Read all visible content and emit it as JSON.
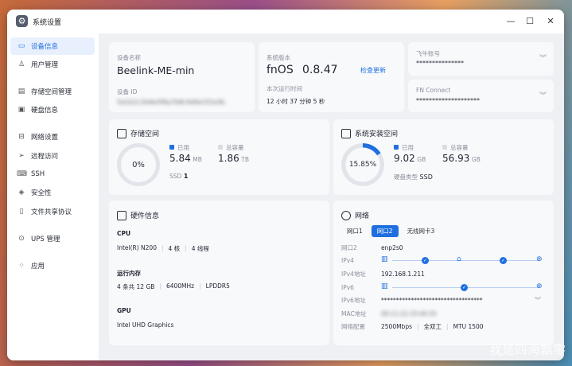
{
  "window": {
    "title": "系统设置",
    "minimize": "—",
    "maximize": "☐",
    "close": "✕"
  },
  "sidebar": {
    "items": [
      {
        "label": "设备信息",
        "icon": "device-icon",
        "active": true
      },
      {
        "label": "用户管理",
        "icon": "user-icon"
      },
      {
        "label": "存储空间管理",
        "icon": "storage-icon"
      },
      {
        "label": "硬盘信息",
        "icon": "disk-icon"
      },
      {
        "label": "网络设置",
        "icon": "network-icon"
      },
      {
        "label": "远程访问",
        "icon": "remote-icon"
      },
      {
        "label": "SSH",
        "icon": "terminal-icon"
      },
      {
        "label": "安全性",
        "icon": "shield-icon"
      },
      {
        "label": "文件共享协议",
        "icon": "file-share-icon"
      },
      {
        "label": "UPS 管理",
        "icon": "power-icon"
      },
      {
        "label": "应用",
        "icon": "apps-icon"
      }
    ]
  },
  "device": {
    "name_label": "设备名称",
    "name": "Beelink-ME-min",
    "id_label": "设备 ID",
    "id_value": "5a1b2c3d4e5f6a7b8c9d0e1f2a3b"
  },
  "system": {
    "version_label": "系统版本",
    "os": "fnOS",
    "version": "0.8.47",
    "check_update": "检查更新",
    "uptime_label": "本次运行时间",
    "uptime": "12 小时 37 分钟 5 秒"
  },
  "accounts": {
    "feiniu_label": "飞牛账号",
    "feiniu_value": "***************",
    "fnconnect_label": "FN Connect",
    "fnconnect_value": "********************"
  },
  "storage": {
    "title": "存储空间",
    "percent": "0%",
    "used_label": "已用",
    "used": "5.84",
    "used_unit": "MB",
    "total_label": "总容量",
    "total": "1.86",
    "total_unit": "TB",
    "disk_type": "SSD",
    "disk_count": "1",
    "fraction": 0.0
  },
  "system_space": {
    "title": "系统安装空间",
    "percent": "15.85%",
    "used_label": "已用",
    "used": "9.02",
    "used_unit": "GB",
    "total_label": "总容量",
    "total": "56.93",
    "total_unit": "GB",
    "disk_type_label": "硬盘类型",
    "disk_type": "SSD",
    "fraction": 0.1585
  },
  "hardware": {
    "title": "硬件信息",
    "cpu_label": "CPU",
    "cpu_model": "Intel(R) N200",
    "cores": "4 核",
    "threads": "4 线程",
    "ram_label": "运行内存",
    "ram_slots": "4 条共 12 GB",
    "ram_speed": "6400MHz",
    "ram_type": "LPDDR5",
    "gpu_label": "GPU",
    "gpu_model": "Intel UHD Graphics"
  },
  "network": {
    "title": "网络",
    "tabs": [
      "网口1",
      "网口2",
      "无线网卡3"
    ],
    "active_tab": 1,
    "rows": {
      "port_label": "网口2",
      "port_value": "enp2s0",
      "ipv4_label": "IPv4",
      "ipv4_addr_label": "IPv4地址",
      "ipv4_addr": "192.168.1.211",
      "ipv6_label": "IPv6",
      "ipv6_addr_label": "IPv6地址",
      "ipv6_addr": "**********************************",
      "mac_label": "MAC地址",
      "mac_value": "00:11:22:33:44:55",
      "config_label": "网络配置",
      "speed": "2500Mbps",
      "duplex": "全双工",
      "mtu": "MTU 1500"
    }
  },
  "watermark": "我是四海飘零",
  "colors": {
    "accent": "#1f6fe0",
    "active_nav_bg": "#e8f0fd"
  }
}
